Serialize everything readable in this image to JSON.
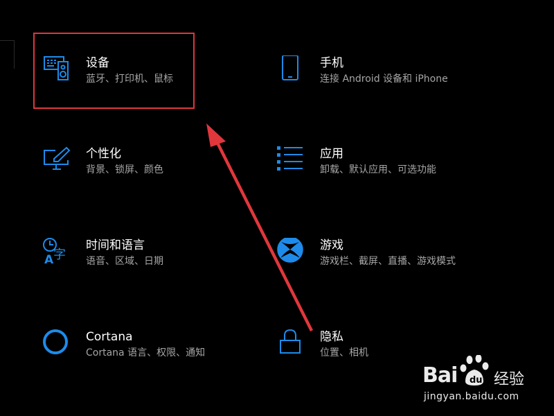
{
  "settings": {
    "tiles": [
      {
        "id": "devices",
        "title": "设备",
        "desc": "蓝牙、打印机、鼠标",
        "icon": "devices-icon"
      },
      {
        "id": "phone",
        "title": "手机",
        "desc": "连接 Android 设备和 iPhone",
        "icon": "phone-icon"
      },
      {
        "id": "personalization",
        "title": "个性化",
        "desc": "背景、锁屏、颜色",
        "icon": "personalization-icon"
      },
      {
        "id": "apps",
        "title": "应用",
        "desc": "卸载、默认应用、可选功能",
        "icon": "apps-list-icon"
      },
      {
        "id": "time-language",
        "title": "时间和语言",
        "desc": "语音、区域、日期",
        "icon": "time-language-icon"
      },
      {
        "id": "gaming",
        "title": "游戏",
        "desc": "游戏栏、截屏、直播、游戏模式",
        "icon": "xbox-icon"
      },
      {
        "id": "cortana",
        "title": "Cortana",
        "desc": "Cortana 语言、权限、通知",
        "icon": "cortana-icon"
      },
      {
        "id": "privacy",
        "title": "隐私",
        "desc": "位置、相机",
        "icon": "lock-icon"
      }
    ]
  },
  "colors": {
    "background": "#000000",
    "accent": "#1e8bea",
    "title": "#ffffff",
    "description": "#a6a6a6",
    "annotation": "#e0373c"
  },
  "watermark": {
    "brand": "Bai",
    "sub": "经验",
    "url": "jingyan.baidu.com",
    "icon": "baidu-paw-icon"
  }
}
